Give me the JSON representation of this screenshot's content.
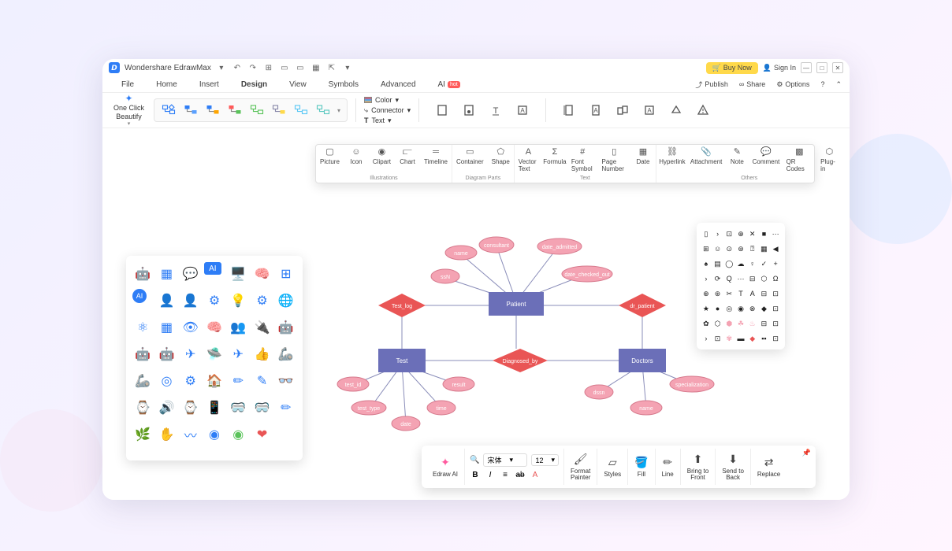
{
  "app_title": "Wondershare EdrawMax",
  "titlebar": {
    "buy_now": "Buy Now",
    "sign_in": "Sign In"
  },
  "menu": {
    "tabs": [
      "File",
      "Home",
      "Insert",
      "Design",
      "View",
      "Symbols",
      "Advanced",
      "AI"
    ],
    "active_index": 3,
    "hot_badge": "hot",
    "right": {
      "publish": "Publish",
      "share": "Share",
      "options": "Options"
    }
  },
  "ribbon": {
    "one_click": "One Click\nBeautify",
    "color": "Color",
    "connector": "Connector",
    "text": "Text"
  },
  "insert_panel": {
    "groups": [
      {
        "label": "Illustrations",
        "items": [
          "Picture",
          "Icon",
          "Clipart",
          "Chart",
          "Timeline"
        ]
      },
      {
        "label": "Diagram Parts",
        "items": [
          "Container",
          "Shape"
        ]
      },
      {
        "label": "Text",
        "items": [
          "Vector Text",
          "Formula",
          "Font Symbol",
          "Page Number",
          "Date"
        ]
      },
      {
        "label": "Others",
        "items": [
          "Hyperlink",
          "Attachment",
          "Note",
          "Comment",
          "QR Codes",
          "Plug-in"
        ]
      }
    ]
  },
  "diagram": {
    "entities": {
      "patient": "Patient",
      "test": "Test",
      "doctors": "Doctors"
    },
    "relationships": {
      "test_log": "Test_log",
      "dr_patient": "dr_patient",
      "diagnosed_by": "Diagnosed_by"
    },
    "attributes": {
      "patient": [
        "consultant",
        "name",
        "date_admitted",
        "ssN",
        "date_checked_out"
      ],
      "test": [
        "test_id",
        "test_type",
        "date",
        "time",
        "result"
      ],
      "doctors": [
        "dssn",
        "name",
        "specialization"
      ]
    }
  },
  "format_bar": {
    "ai": "Edraw AI",
    "font": "宋体",
    "size": "12",
    "painter": "Format\nPainter",
    "styles": "Styles",
    "fill": "Fill",
    "line": "Line",
    "front": "Bring to\nFront",
    "back": "Send to\nBack",
    "replace": "Replace"
  }
}
